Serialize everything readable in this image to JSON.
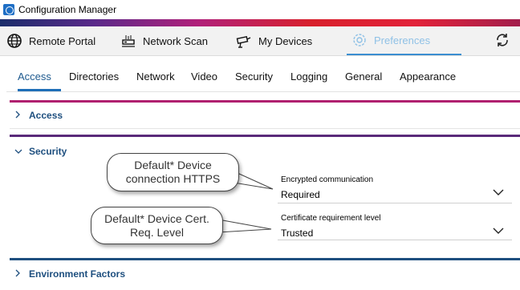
{
  "window": {
    "title": "Configuration Manager"
  },
  "toolbar": {
    "items": [
      {
        "label": "Remote Portal"
      },
      {
        "label": "Network Scan"
      },
      {
        "label": "My Devices"
      },
      {
        "label": "Preferences"
      }
    ]
  },
  "tabs": [
    "Access",
    "Directories",
    "Network",
    "Video",
    "Security",
    "Logging",
    "General",
    "Appearance"
  ],
  "sections": {
    "access": {
      "label": "Access"
    },
    "security": {
      "label": "Security"
    },
    "environment": {
      "label": "Environment Factors"
    }
  },
  "fields": {
    "encrypted": {
      "label": "Encrypted communication",
      "value": "Required"
    },
    "certificate": {
      "label": "Certificate requirement level",
      "value": "Trusted"
    }
  },
  "callouts": {
    "https": {
      "line1": "Default* Device",
      "line2": "connection HTTPS"
    },
    "cert": {
      "line1": "Default* Device Cert.",
      "line2": "Req. Level"
    }
  },
  "colors": {
    "accent": "#1e6fb8",
    "access_bar": "#b0206f",
    "security_bar": "#5a2a7a",
    "environment_bar": "#1e4f7f"
  }
}
